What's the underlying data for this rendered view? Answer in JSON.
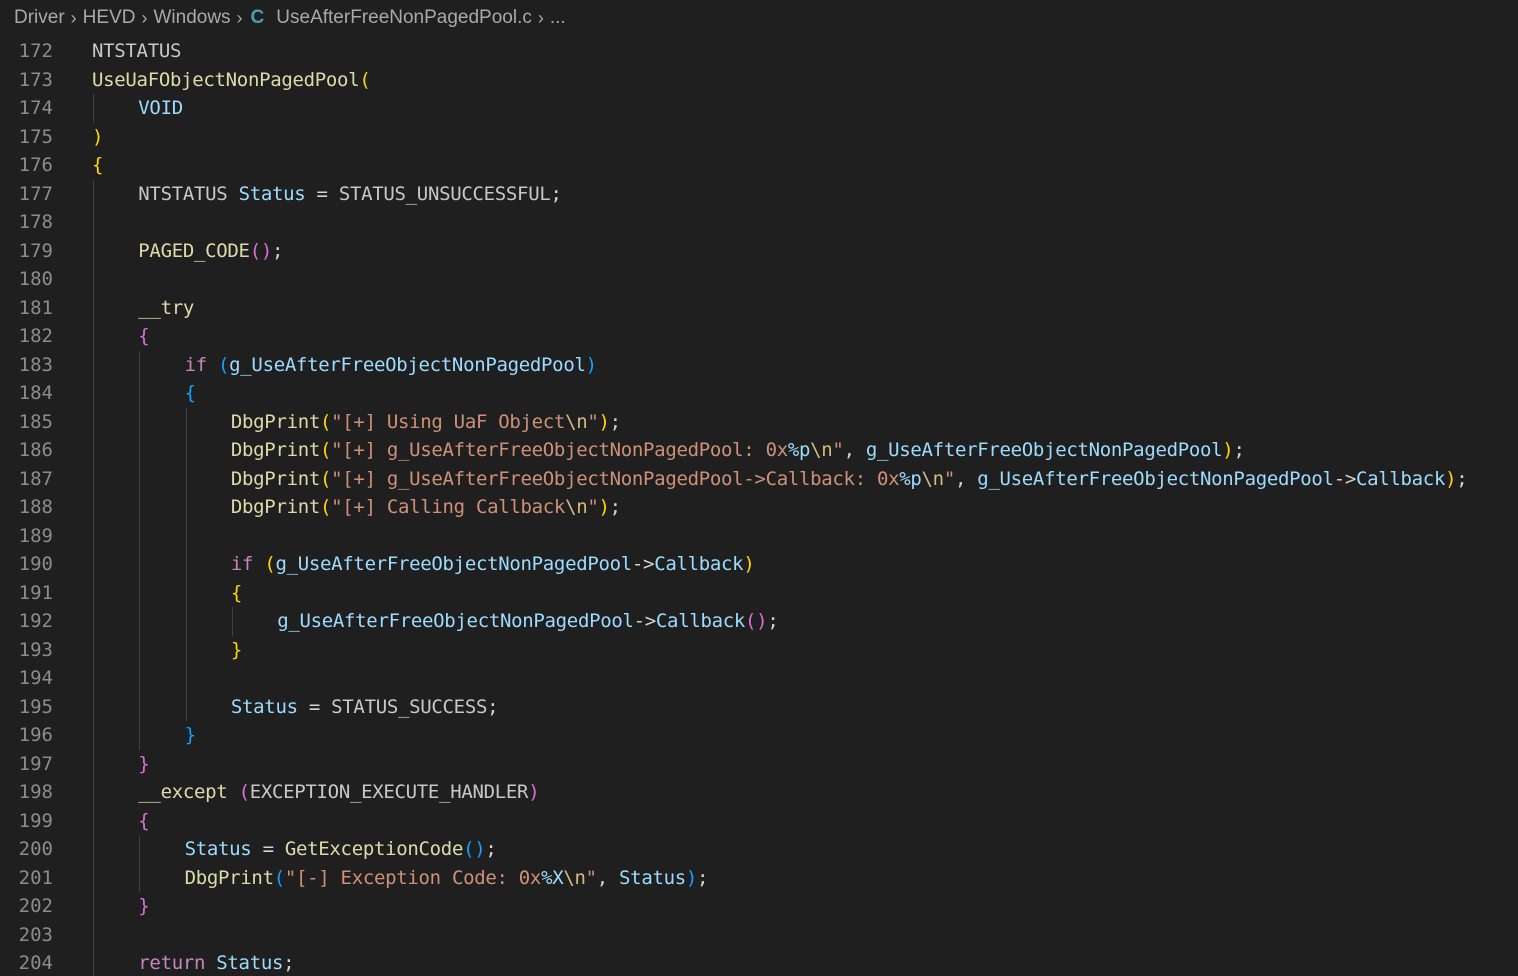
{
  "breadcrumb": {
    "items": [
      "Driver",
      "HEVD",
      "Windows"
    ],
    "file_icon": "C",
    "file": "UseAfterFreeNonPagedPool.c",
    "more": "..."
  },
  "editor": {
    "lines": [
      {
        "n": "172",
        "indent": 0,
        "tokens": [
          [
            "mac",
            "NTSTATUS"
          ]
        ]
      },
      {
        "n": "173",
        "indent": 0,
        "tokens": [
          [
            "fn",
            "UseUaFObjectNonPagedPool"
          ],
          [
            "b1",
            "("
          ]
        ]
      },
      {
        "n": "174",
        "indent": 1,
        "tokens": [
          [
            "var",
            "VOID"
          ]
        ]
      },
      {
        "n": "175",
        "indent": 0,
        "tokens": [
          [
            "b1",
            ")"
          ]
        ]
      },
      {
        "n": "176",
        "indent": 0,
        "tokens": [
          [
            "b1",
            "{"
          ]
        ]
      },
      {
        "n": "177",
        "indent": 1,
        "tokens": [
          [
            "mac",
            "NTSTATUS "
          ],
          [
            "var",
            "Status"
          ],
          [
            "txt",
            " = "
          ],
          [
            "mac",
            "STATUS_UNSUCCESSFUL"
          ],
          [
            "txt",
            ";"
          ]
        ]
      },
      {
        "n": "178",
        "indent": 1,
        "tokens": []
      },
      {
        "n": "179",
        "indent": 1,
        "tokens": [
          [
            "fn",
            "PAGED_CODE"
          ],
          [
            "b2",
            "()"
          ],
          [
            "txt",
            ";"
          ]
        ]
      },
      {
        "n": "180",
        "indent": 1,
        "tokens": []
      },
      {
        "n": "181",
        "indent": 1,
        "tokens": [
          [
            "fn",
            "__try"
          ]
        ]
      },
      {
        "n": "182",
        "indent": 1,
        "tokens": [
          [
            "b2",
            "{"
          ]
        ]
      },
      {
        "n": "183",
        "indent": 2,
        "tokens": [
          [
            "ctl",
            "if "
          ],
          [
            "b3",
            "("
          ],
          [
            "var",
            "g_UseAfterFreeObjectNonPagedPool"
          ],
          [
            "b3",
            ")"
          ]
        ]
      },
      {
        "n": "184",
        "indent": 2,
        "tokens": [
          [
            "b3",
            "{"
          ]
        ]
      },
      {
        "n": "185",
        "indent": 3,
        "tokens": [
          [
            "fn",
            "DbgPrint"
          ],
          [
            "b1",
            "("
          ],
          [
            "str",
            "\"[+] Using UaF Object"
          ],
          [
            "esc",
            "\\n"
          ],
          [
            "str",
            "\""
          ],
          [
            "b1",
            ")"
          ],
          [
            "txt",
            ";"
          ]
        ]
      },
      {
        "n": "186",
        "indent": 3,
        "tokens": [
          [
            "fn",
            "DbgPrint"
          ],
          [
            "b1",
            "("
          ],
          [
            "str",
            "\"[+] g_UseAfterFreeObjectNonPagedPool: 0x"
          ],
          [
            "var",
            "%p"
          ],
          [
            "esc",
            "\\n"
          ],
          [
            "str",
            "\""
          ],
          [
            "txt",
            ", "
          ],
          [
            "var",
            "g_UseAfterFreeObjectNonPagedPool"
          ],
          [
            "b1",
            ")"
          ],
          [
            "txt",
            ";"
          ]
        ]
      },
      {
        "n": "187",
        "indent": 3,
        "tokens": [
          [
            "fn",
            "DbgPrint"
          ],
          [
            "b1",
            "("
          ],
          [
            "str",
            "\"[+] g_UseAfterFreeObjectNonPagedPool->Callback: 0x"
          ],
          [
            "var",
            "%p"
          ],
          [
            "esc",
            "\\n"
          ],
          [
            "str",
            "\""
          ],
          [
            "txt",
            ", "
          ],
          [
            "var",
            "g_UseAfterFreeObjectNonPagedPool"
          ],
          [
            "txt",
            "->"
          ],
          [
            "var",
            "Callback"
          ],
          [
            "b1",
            ")"
          ],
          [
            "txt",
            ";"
          ]
        ]
      },
      {
        "n": "188",
        "indent": 3,
        "tokens": [
          [
            "fn",
            "DbgPrint"
          ],
          [
            "b1",
            "("
          ],
          [
            "str",
            "\"[+] Calling Callback"
          ],
          [
            "esc",
            "\\n"
          ],
          [
            "str",
            "\""
          ],
          [
            "b1",
            ")"
          ],
          [
            "txt",
            ";"
          ]
        ]
      },
      {
        "n": "189",
        "indent": 3,
        "tokens": []
      },
      {
        "n": "190",
        "indent": 3,
        "tokens": [
          [
            "ctl",
            "if "
          ],
          [
            "b1",
            "("
          ],
          [
            "var",
            "g_UseAfterFreeObjectNonPagedPool"
          ],
          [
            "txt",
            "->"
          ],
          [
            "var",
            "Callback"
          ],
          [
            "b1",
            ")"
          ]
        ]
      },
      {
        "n": "191",
        "indent": 3,
        "tokens": [
          [
            "b1",
            "{"
          ]
        ]
      },
      {
        "n": "192",
        "indent": 4,
        "tokens": [
          [
            "var",
            "g_UseAfterFreeObjectNonPagedPool"
          ],
          [
            "txt",
            "->"
          ],
          [
            "var",
            "Callback"
          ],
          [
            "b2",
            "()"
          ],
          [
            "txt",
            ";"
          ]
        ]
      },
      {
        "n": "193",
        "indent": 3,
        "tokens": [
          [
            "b1",
            "}"
          ]
        ]
      },
      {
        "n": "194",
        "indent": 3,
        "tokens": []
      },
      {
        "n": "195",
        "indent": 3,
        "tokens": [
          [
            "var",
            "Status"
          ],
          [
            "txt",
            " = "
          ],
          [
            "mac",
            "STATUS_SUCCESS"
          ],
          [
            "txt",
            ";"
          ]
        ]
      },
      {
        "n": "196",
        "indent": 2,
        "tokens": [
          [
            "b3",
            "}"
          ]
        ]
      },
      {
        "n": "197",
        "indent": 1,
        "tokens": [
          [
            "b2",
            "}"
          ]
        ]
      },
      {
        "n": "198",
        "indent": 1,
        "tokens": [
          [
            "fn",
            "__except "
          ],
          [
            "b2",
            "("
          ],
          [
            "mac",
            "EXCEPTION_EXECUTE_HANDLER"
          ],
          [
            "b2",
            ")"
          ]
        ]
      },
      {
        "n": "199",
        "indent": 1,
        "tokens": [
          [
            "b2",
            "{"
          ]
        ]
      },
      {
        "n": "200",
        "indent": 2,
        "tokens": [
          [
            "var",
            "Status"
          ],
          [
            "txt",
            " = "
          ],
          [
            "fn",
            "GetExceptionCode"
          ],
          [
            "b3",
            "()"
          ],
          [
            "txt",
            ";"
          ]
        ]
      },
      {
        "n": "201",
        "indent": 2,
        "tokens": [
          [
            "fn",
            "DbgPrint"
          ],
          [
            "b3",
            "("
          ],
          [
            "str",
            "\"[-] Exception Code: 0x"
          ],
          [
            "var",
            "%X"
          ],
          [
            "esc",
            "\\n"
          ],
          [
            "str",
            "\""
          ],
          [
            "txt",
            ", "
          ],
          [
            "var",
            "Status"
          ],
          [
            "b3",
            ")"
          ],
          [
            "txt",
            ";"
          ]
        ]
      },
      {
        "n": "202",
        "indent": 1,
        "tokens": [
          [
            "b2",
            "}"
          ]
        ]
      },
      {
        "n": "203",
        "indent": 1,
        "tokens": []
      },
      {
        "n": "204",
        "indent": 1,
        "tokens": [
          [
            "ctl",
            "return "
          ],
          [
            "var",
            "Status"
          ],
          [
            "txt",
            ";"
          ]
        ]
      }
    ]
  }
}
